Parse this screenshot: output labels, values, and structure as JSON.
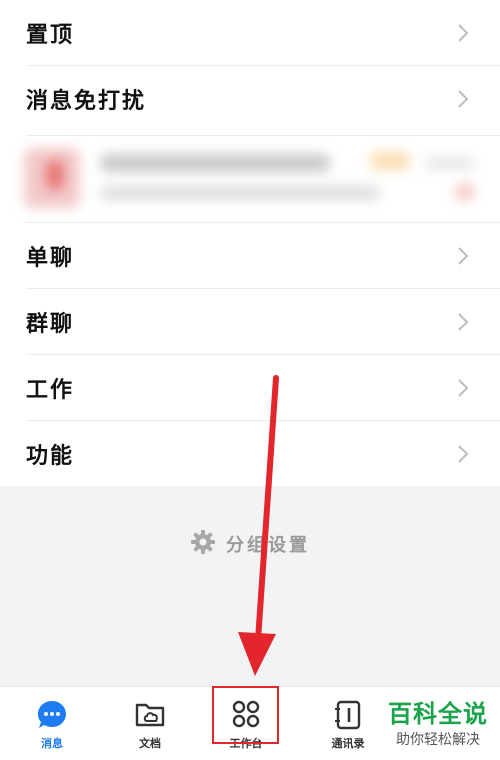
{
  "rows": [
    {
      "label": "置顶"
    },
    {
      "label": "消息免打扰"
    },
    {
      "label": "单聊"
    },
    {
      "label": "群聊"
    },
    {
      "label": "工作"
    },
    {
      "label": "功能"
    }
  ],
  "settings_link": {
    "label": "分组设置",
    "icon": "gear-icon"
  },
  "tabbar": {
    "tabs": [
      {
        "label": "消息",
        "icon": "chat-bubble-icon",
        "active": true
      },
      {
        "label": "文档",
        "icon": "folder-cloud-icon",
        "active": false
      },
      {
        "label": "工作台",
        "icon": "grid-apps-icon",
        "active": false
      },
      {
        "label": "通讯录",
        "icon": "contacts-book-icon",
        "active": false
      }
    ]
  },
  "watermark": {
    "title": "百科全说",
    "subtitle": "助你轻松解决"
  },
  "colors": {
    "accent": "#1e7bf0",
    "highlight": "#e3262b",
    "watermark": "#1aa34a",
    "background": "#f2f3f5"
  }
}
